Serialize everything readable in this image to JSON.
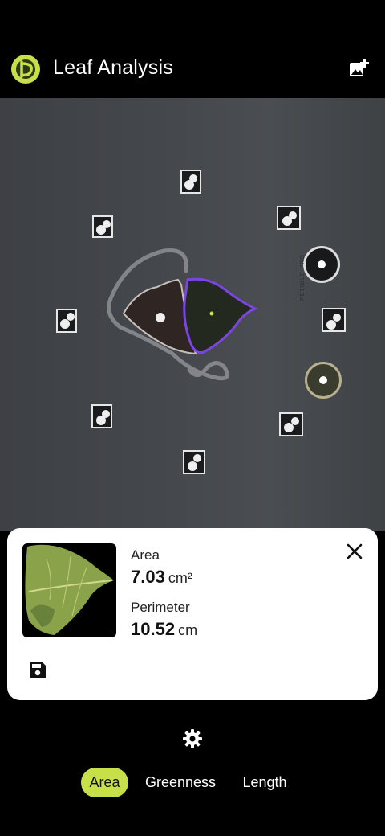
{
  "app": {
    "title": "Leaf Analysis",
    "accent_color": "#c7e04a",
    "logo_icon": "leaf-app-logo",
    "add_photo_icon": "add-photo-icon"
  },
  "camera": {
    "imprint_text": "PETIOLE PRO",
    "outline_color": "#7b45e6"
  },
  "result_card": {
    "area_label": "Area",
    "area_value": "7.03",
    "area_unit": "cm²",
    "perimeter_label": "Perimeter",
    "perimeter_value": "10.52",
    "perimeter_unit": "cm",
    "close_icon": "close-icon",
    "save_icon": "save-icon"
  },
  "bottom": {
    "settings_icon": "gear-icon",
    "tabs": [
      {
        "label": "Area",
        "active": true
      },
      {
        "label": "Greenness",
        "active": false
      },
      {
        "label": "Length",
        "active": false
      }
    ]
  }
}
